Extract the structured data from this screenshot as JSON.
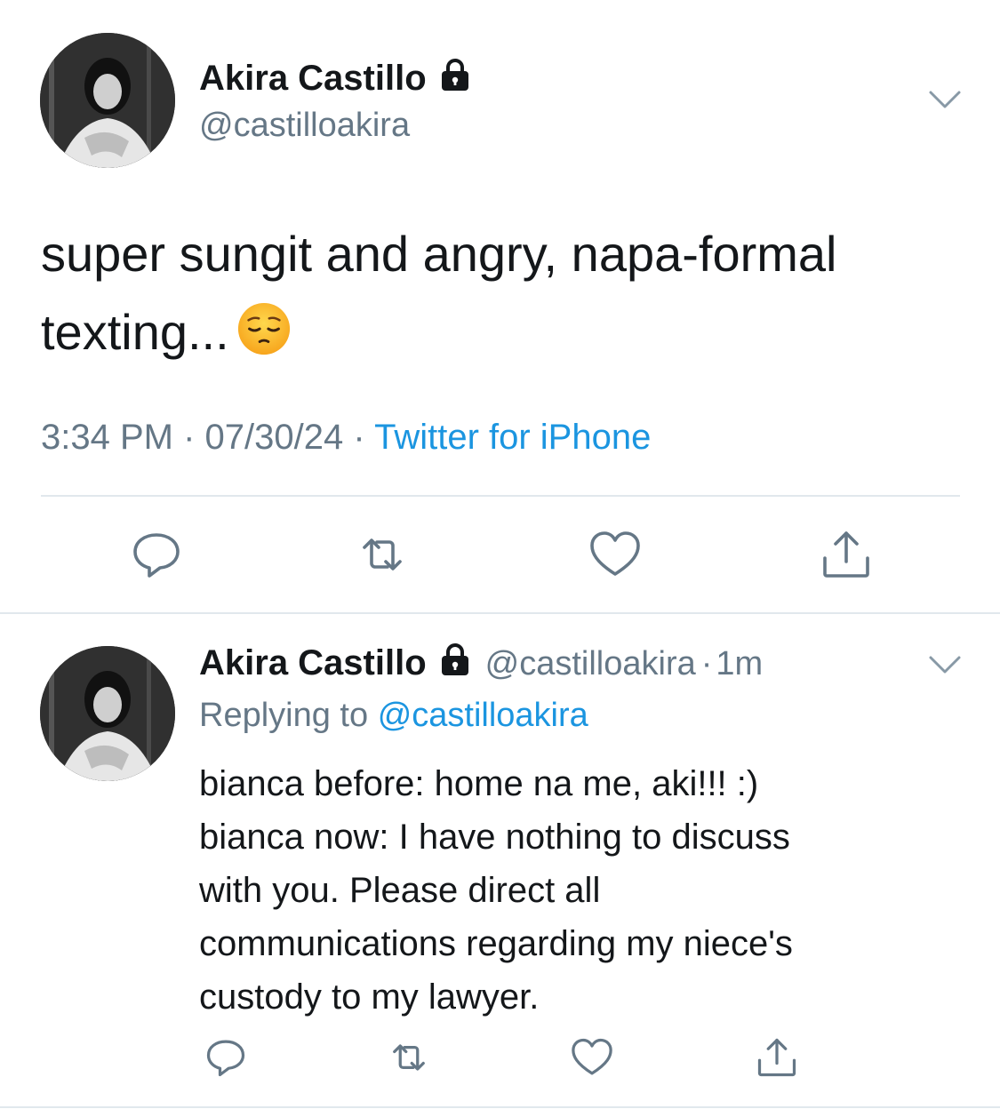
{
  "tweet": {
    "author_name": "Akira Castillo",
    "author_handle": "@castilloakira",
    "text": "super sungit and angry, napa-formal texting...",
    "emoji_name": "pensive-face",
    "time": "3:34 PM",
    "date": "07/30/24",
    "source": "Twitter for iPhone",
    "separator": "·"
  },
  "reply": {
    "author_name": "Akira Castillo",
    "author_handle": "@castilloakira",
    "age": "1m",
    "replying_prefix": "Replying to",
    "replying_handle": "@castilloakira",
    "lines": [
      "bianca before: home na me, aki!!! :)",
      "bianca now: I have nothing to discuss",
      "with you. Please direct all",
      "communications regarding my niece's",
      "custody to my lawyer."
    ]
  },
  "icons": {
    "lock": "lock-icon",
    "more": "chevron-down-icon",
    "reply": "reply-icon",
    "retweet": "retweet-icon",
    "like": "heart-icon",
    "share": "share-icon"
  },
  "colors": {
    "text": "#14171a",
    "secondary": "#657786",
    "link": "#1b95e0",
    "divider": "#e1e8ed"
  }
}
